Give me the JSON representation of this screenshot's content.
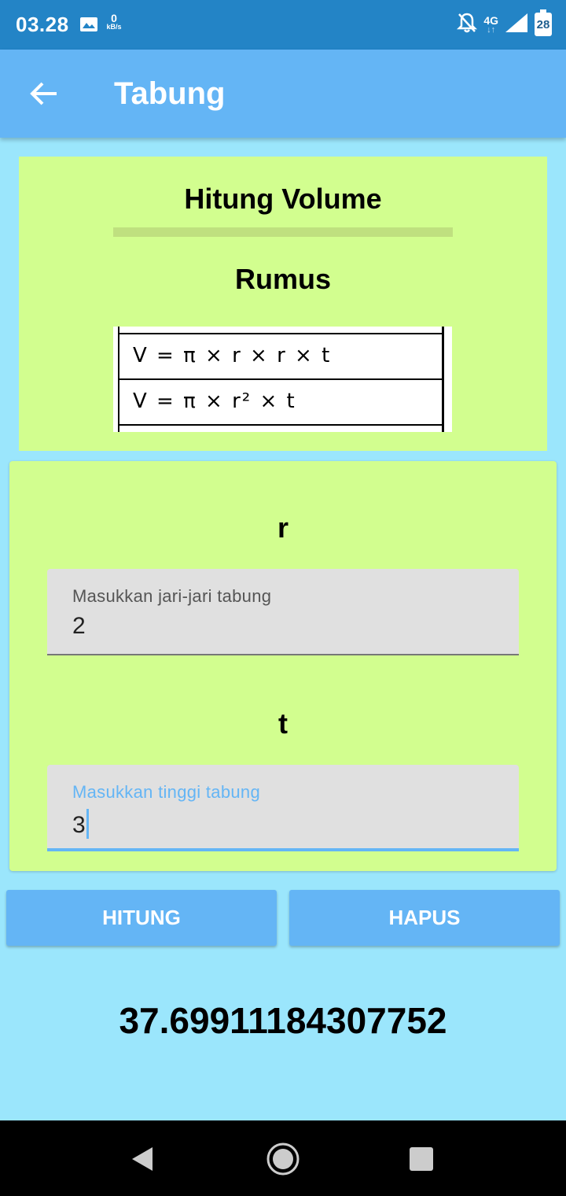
{
  "status_bar": {
    "time": "03.28",
    "net_speed_value": "0",
    "net_speed_unit": "kB/s",
    "network_type": "4G",
    "battery_level": "28",
    "icons": [
      "gallery-icon",
      "mute-icon",
      "signal-icon",
      "battery-icon"
    ]
  },
  "app_bar": {
    "title": "Tabung",
    "back_icon": "arrow-back-icon",
    "background": "#64b5f5"
  },
  "volume_card": {
    "heading": "Hitung Volume",
    "formula_heading": "Rumus",
    "formula_lines": [
      "V = π × r × r × t",
      "V = π × r² × t"
    ],
    "background": "#d2fe8f"
  },
  "inputs": {
    "radius": {
      "label": "r",
      "placeholder": "Masukkan jari-jari tabung",
      "value": "2"
    },
    "height": {
      "label": "t",
      "placeholder": "Masukkan tinggi tabung",
      "value": "3",
      "focused": true
    }
  },
  "actions": {
    "calculate_label": "HITUNG",
    "clear_label": "HAPUS"
  },
  "result": "37.69911184307752",
  "colors": {
    "page_background": "#9be6fc",
    "status_bar": "#2384c6",
    "accent": "#64b5f5"
  },
  "nav_bar": {
    "icons": [
      "nav-back-icon",
      "nav-home-icon",
      "nav-recent-apps-icon"
    ]
  }
}
